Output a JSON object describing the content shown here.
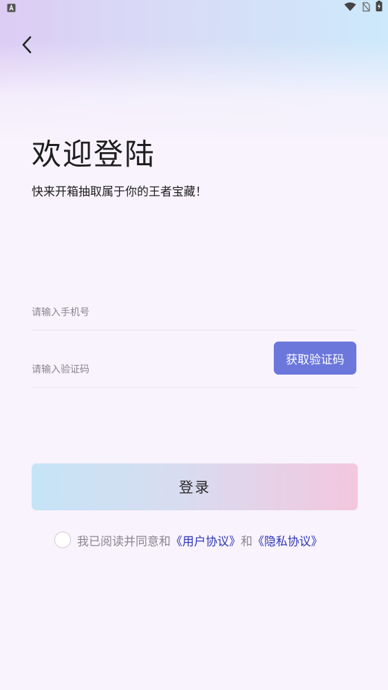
{
  "status_bar": {
    "left_icon": "a-badge-icon",
    "right_icons": [
      "wifi-icon",
      "no-sim-icon",
      "battery-charging-icon"
    ]
  },
  "nav": {
    "back_icon": "chevron-left-icon"
  },
  "header": {
    "title": "欢迎登陆",
    "subtitle": "快来开箱抽取属于你的王者宝藏！"
  },
  "form": {
    "phone_placeholder": "请输入手机号",
    "phone_value": "",
    "code_placeholder": "请输入验证码",
    "code_value": "",
    "get_code_label": "获取验证码",
    "login_label": "登录"
  },
  "agreement": {
    "checked": false,
    "prefix": "我已阅读并同意和",
    "user_agreement": "《用户协议》",
    "connector": "和",
    "privacy_agreement": "《隐私协议》"
  },
  "colors": {
    "accent": "#6b77db",
    "link": "#2f36b8",
    "background": "#f8f3fd"
  }
}
